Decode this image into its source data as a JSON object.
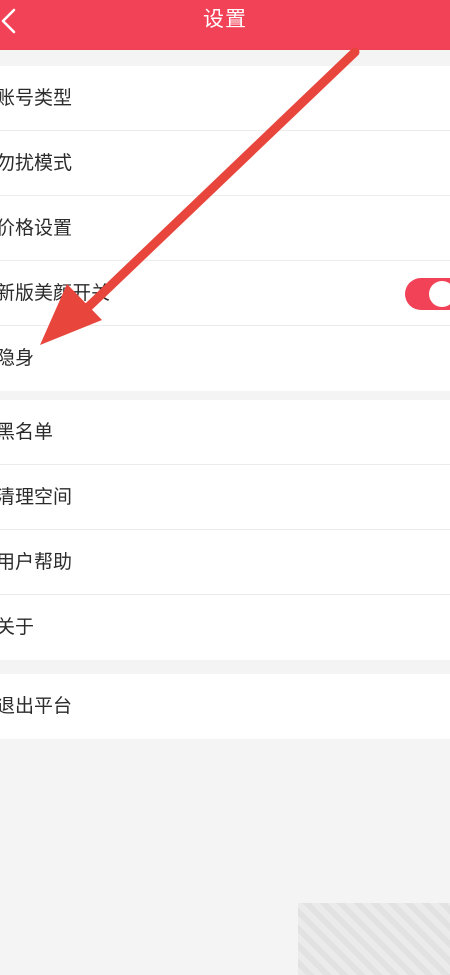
{
  "header": {
    "title": "设置",
    "accent_color": "#f24258",
    "back_icon": "chevron-left-icon"
  },
  "settings": {
    "group1": [
      {
        "label": "账号类型"
      },
      {
        "label": "勿扰模式"
      },
      {
        "label": "价格设置"
      },
      {
        "label": "新版美颜开关",
        "toggle": "on"
      },
      {
        "label": "隐身"
      }
    ],
    "group2": [
      {
        "label": "黑名单"
      },
      {
        "label": "清理空间"
      },
      {
        "label": "用户帮助"
      },
      {
        "label": "关于"
      }
    ],
    "group3": [
      {
        "label": "退出平台"
      }
    ]
  },
  "annotation": {
    "arrow_color": "#e8463c"
  }
}
